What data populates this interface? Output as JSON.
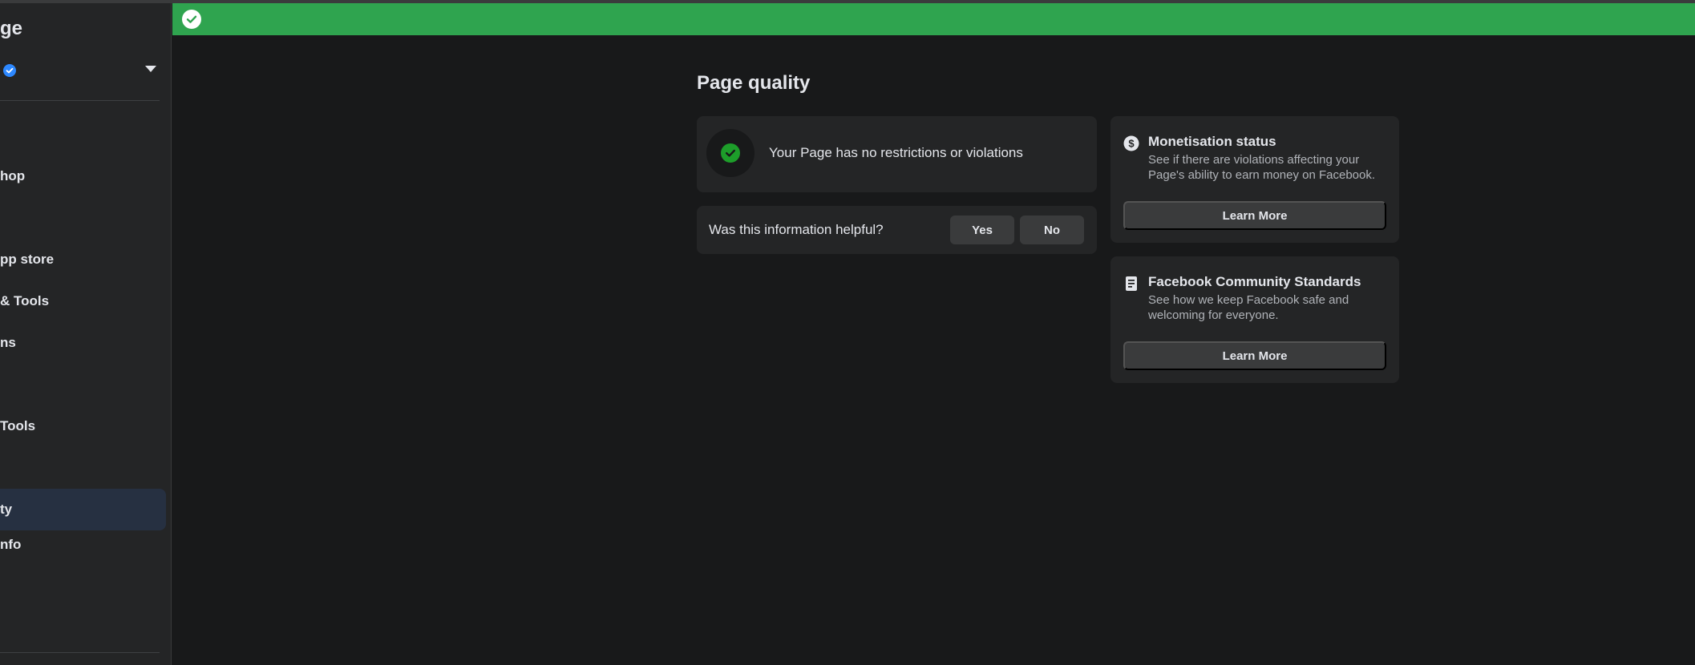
{
  "sidebar": {
    "title": "ge",
    "items": [
      {
        "label": "hop"
      },
      {
        "label": "pp store"
      },
      {
        "label": "& Tools"
      },
      {
        "label": "ns"
      },
      {
        "label": " Tools"
      },
      {
        "label": "ty"
      },
      {
        "label": "nfo"
      }
    ],
    "active_index": 5
  },
  "banner": {
    "color": "#2fa44f",
    "icon": "check-circle-icon"
  },
  "main": {
    "page_title": "Page quality",
    "status": {
      "text": "Your Page has no restrictions or violations",
      "icon": "check-circle-icon"
    },
    "helpful": {
      "question": "Was this information helpful?",
      "yes_label": "Yes",
      "no_label": "No"
    }
  },
  "side_cards": [
    {
      "icon": "dollar-circle-icon",
      "title": "Monetisation status",
      "description": "See if there are violations affecting your Page's ability to earn money on Facebook.",
      "button_label": "Learn More"
    },
    {
      "icon": "document-icon",
      "title": "Facebook Community Standards",
      "description": "See how we keep Facebook safe and welcoming for everyone.",
      "button_label": "Learn More"
    }
  ],
  "colors": {
    "background": "#18191a",
    "card": "#242526",
    "button": "#3a3b3c",
    "accent_blue": "#2d88ff",
    "success_green": "#1d9e2a"
  }
}
